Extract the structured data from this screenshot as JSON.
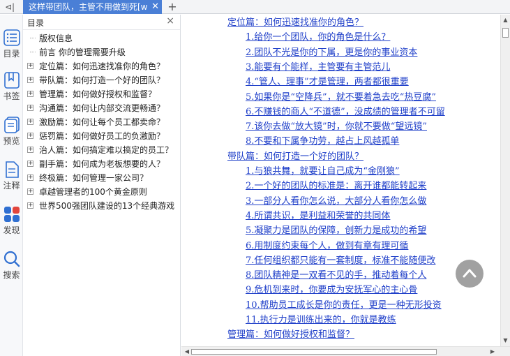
{
  "tab": {
    "title": "这样带团队，主管不用做到死[w",
    "close": "✕",
    "new": "+",
    "back": "⊲|"
  },
  "rail": [
    {
      "label": "目录",
      "icon": "toc-list-icon"
    },
    {
      "label": "书签",
      "icon": "bookmark-icon"
    },
    {
      "label": "预览",
      "icon": "preview-icon"
    },
    {
      "label": "注释",
      "icon": "annotation-icon"
    },
    {
      "label": "发现",
      "icon": "discover-icon"
    },
    {
      "label": "搜索",
      "icon": "search-icon"
    }
  ],
  "toc": {
    "title": "目录",
    "close": "×",
    "items": [
      {
        "label": "版权信息",
        "expandable": false
      },
      {
        "label": "前言 你的管理需要升级",
        "expandable": false
      },
      {
        "label": "定位篇：如何迅速找准你的角色？",
        "expandable": true
      },
      {
        "label": "带队篇：如何打造一个好的团队？",
        "expandable": true
      },
      {
        "label": "管理篇：如何做好授权和监督？",
        "expandable": true
      },
      {
        "label": "沟通篇：如何让内部交流更畅通？",
        "expandable": true
      },
      {
        "label": "激励篇：如何让每个员工都卖命？",
        "expandable": true
      },
      {
        "label": "惩罚篇：如何做好员工的负激励？",
        "expandable": true
      },
      {
        "label": "治人篇：如何搞定难以搞定的员工？",
        "expandable": true
      },
      {
        "label": "副手篇：如何成为老板想要的人？",
        "expandable": true
      },
      {
        "label": "终极篇：如何管理一家公司？",
        "expandable": true
      },
      {
        "label": "卓越管理者的100个黄金原则",
        "expandable": true
      },
      {
        "label": "世界500强团队建设的13个经典游戏",
        "expandable": true
      }
    ]
  },
  "doc": {
    "lines": [
      {
        "level": 1,
        "text": "定位篇：如何迅速找准你的角色？"
      },
      {
        "level": 2,
        "text": "1.给你一个团队，你的角色是什么？"
      },
      {
        "level": 2,
        "text": "2.团队不光是你的下属，更是你的事业资本"
      },
      {
        "level": 2,
        "text": "3.能要有个能样，主管要有主管范儿"
      },
      {
        "level": 2,
        "text": "4.“管人、理事”才是管理，两者都很重要"
      },
      {
        "level": 2,
        "text": "5.如果你是“空降兵”，就不要着急去吃“热豆腐”"
      },
      {
        "level": 2,
        "text": "6.不赚钱的商人“不道德”，没成绩的管理者不可留"
      },
      {
        "level": 2,
        "text": "7.该你去做“放大镜”时，你就不要做“望远镜”"
      },
      {
        "level": 2,
        "text": "8.不要和下属争功劳，越占上风越孤单"
      },
      {
        "level": 1,
        "text": "带队篇：如何打造一个好的团队？"
      },
      {
        "level": 2,
        "text": "1.与狼共舞，就要让自己成为“金刚狼”"
      },
      {
        "level": 2,
        "text": "2.一个好的团队的标准是：离开谁都能转起来"
      },
      {
        "level": 2,
        "text": "3.一部分人看你怎么说，大部分人看你怎么做"
      },
      {
        "level": 2,
        "text": "4.所谓共识，是利益和荣誉的共同体"
      },
      {
        "level": 2,
        "text": "5.凝聚力是团队的保障，创新力是成功的希望"
      },
      {
        "level": 2,
        "text": "6.用制度约束每个人，做到有章有理可循"
      },
      {
        "level": 2,
        "text": "7.任何组织都只能有一套制度，标准不能随便改"
      },
      {
        "level": 2,
        "text": "8.团队精神是一双看不见的手，推动着每个人"
      },
      {
        "level": 2,
        "text": "9.危机到来时，你要成为安抚军心的主心骨"
      },
      {
        "level": 2,
        "text": "10.帮助员工成长是你的责任，更是一种无形投资"
      },
      {
        "level": 2,
        "text": "11.执行力是训练出来的，你就是教练"
      },
      {
        "level": 1,
        "text": "管理篇：如何做好授权和监督？"
      }
    ]
  },
  "colors": {
    "tab_active": "#4a7fd6",
    "link": "#1f3fc9",
    "rail_blue": "#2f6fd1",
    "discover_red": "#e2453c"
  }
}
